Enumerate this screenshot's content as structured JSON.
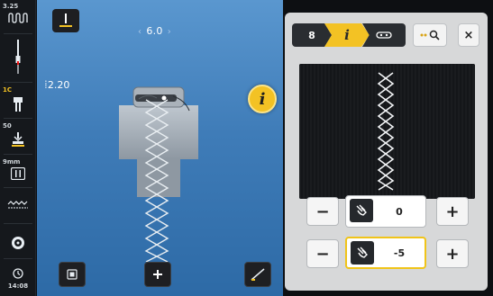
{
  "sidebar": {
    "stitch_width_small": "3.25",
    "presser_foot_number": "1C",
    "presser_foot_pressure": "50",
    "needle_size": "9mm",
    "time": "14:08"
  },
  "main": {
    "stitch_width": "6.0",
    "stitch_length": "2.20"
  },
  "panel": {
    "tab_pattern_number": "8",
    "tab_info_glyph": "i",
    "control1": {
      "minus": "−",
      "plus": "+",
      "value": "0"
    },
    "control2": {
      "minus": "−",
      "plus": "+",
      "value": "-5"
    },
    "zoom_label": "⊕⊖",
    "close_label": "×"
  },
  "colors": {
    "accent": "#f3c224",
    "blue_bg": "#4a88c4",
    "panel_bg": "#d7d8d9"
  }
}
